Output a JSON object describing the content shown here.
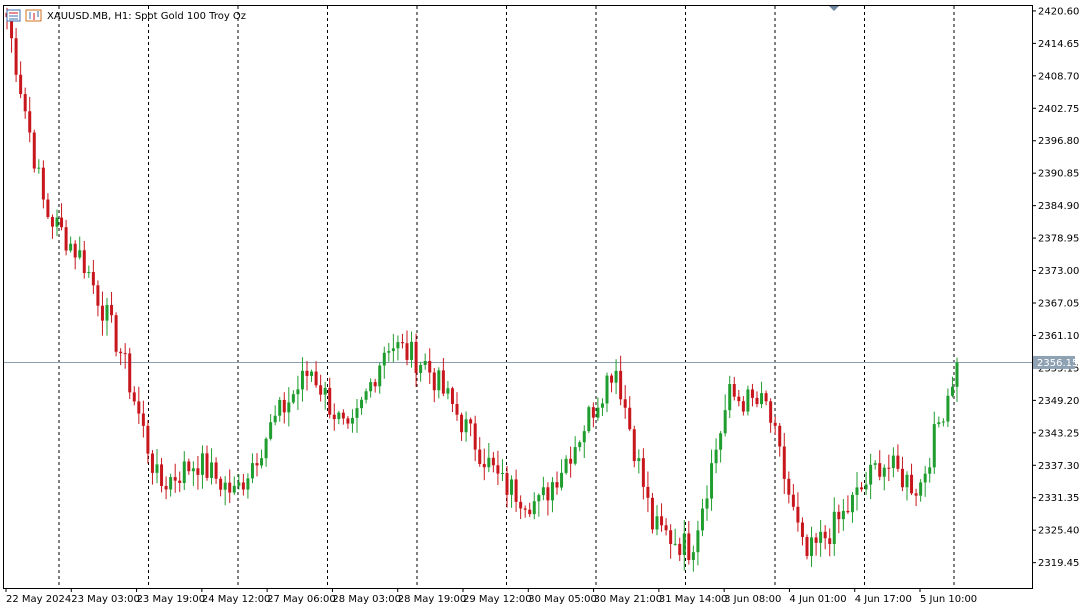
{
  "window": {
    "title": "XAUUSD.MB, H1:  Spot Gold 100 Troy Oz",
    "icons": [
      "chart-window-icon",
      "chart-window-icon-2"
    ]
  },
  "colors": {
    "bull": "#1f9d2e",
    "bear": "#c8161d",
    "vgrid": "#000000",
    "price_line": "#8aa0b0",
    "price_tag_bg": "#8ea2b4",
    "axis": "#000000",
    "shift_marker": "#6d86a0"
  },
  "chart_data": {
    "type": "candlestick",
    "symbol": "XAUUSD.MB",
    "timeframe": "H1",
    "description": "Spot Gold 100 Troy Oz",
    "ylim": [
      2314.8,
      2421.5
    ],
    "y_ticks": [
      "2420.60",
      "2414.65",
      "2408.70",
      "2402.75",
      "2396.80",
      "2390.85",
      "2384.90",
      "2378.95",
      "2373.00",
      "2367.05",
      "2361.10",
      "2355.15",
      "2349.20",
      "2343.25",
      "2337.30",
      "2331.35",
      "2325.40",
      "2319.45"
    ],
    "current_price": "2356.15",
    "x_labels": [
      "22 May 2024",
      "23 May 03:00",
      "23 May 19:00",
      "24 May 12:00",
      "27 May 06:00",
      "28 May 03:00",
      "28 May 19:00",
      "29 May 12:00",
      "30 May 05:00",
      "30 May 21:00",
      "31 May 14:00",
      "3 Jun 08:00",
      "4 Jun 01:00",
      "4 Jun 17:00",
      "5 Jun 10:00"
    ],
    "period_separators": 11,
    "grid": "vertical dashed day separators",
    "key_closes": [
      2419.5,
      2384.0,
      2375.0,
      2358.0,
      2333.5,
      2338.0,
      2332.0,
      2345.0,
      2355.0,
      2342.0,
      2360.0,
      2356.0,
      2345.0,
      2334.0,
      2330.0,
      2342.0,
      2356.0,
      2326.0,
      2322.0,
      2350.0,
      2348.0,
      2320.0,
      2328.0,
      2338.0,
      2333.0,
      2356.2
    ]
  }
}
